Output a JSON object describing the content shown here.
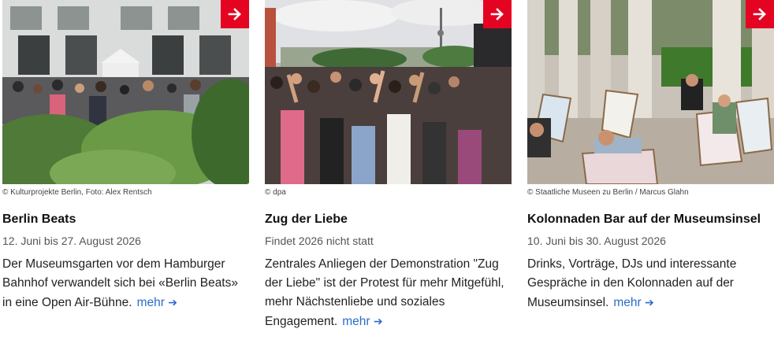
{
  "cards": [
    {
      "credit": "© Kulturprojekte Berlin, Foto: Alex Rentsch",
      "title": "Berlin Beats",
      "date": "12. Juni bis 27. August 2026",
      "description": "Der Museumsgarten vor dem Hamburger Bahnhof verwandelt sich bei «Berlin Beats» in eine Open Air-Bühne.",
      "more_label": "mehr",
      "image_alt": "crowd-in-museum-garden-photo"
    },
    {
      "credit": "© dpa",
      "title": "Zug der Liebe",
      "date": "Findet 2026 nicht statt",
      "description": "Zentrales Anliegen der Demonstration \"Zug der Liebe\" ist der Protest für mehr Mitgefühl, mehr Nächstenliebe und soziales Engagement.",
      "more_label": "mehr",
      "image_alt": "street-parade-crowd-photo"
    },
    {
      "credit": "© Staatliche Museen zu Berlin / Marcus Glahn",
      "title": "Kolonnaden Bar auf der Museumsinsel",
      "date": "10. Juni bis 30. August 2026",
      "description": "Drinks, Vorträge, DJs und interessante Gespräche in den Kolonnaden auf der Museumsinsel.",
      "more_label": "mehr",
      "image_alt": "deck-chairs-in-colonnade-photo"
    }
  ],
  "colors": {
    "accent_red": "#e40422",
    "link_blue": "#2c6bc7"
  },
  "icons": {
    "teaser_button": "arrow-right-icon",
    "more_link": "arrow-right-icon"
  }
}
